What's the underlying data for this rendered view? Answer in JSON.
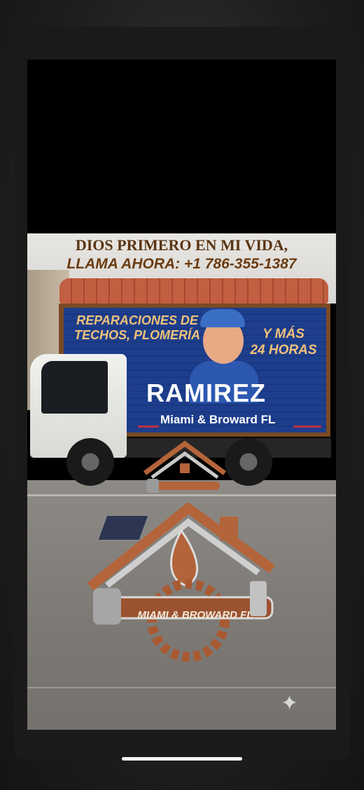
{
  "video": {
    "headline_line1": "DIOS PRIMERO EN MI VIDA,",
    "headline_line2": "LLAMA AHORA: +1 786-355-1387",
    "truck": {
      "left_text_line1": "REPARACIONES DE",
      "left_text_line2": "TECHOS, PLOMERÍA",
      "right_text_line1": "Y MÁS",
      "right_text_line2": "24 HORAS",
      "brand_name": "RAMIREZ",
      "brand_sub": "Miami & Broward FL"
    },
    "logo_text": "MIAMI & BROWARD FL",
    "sparkle_icon": "sparkle-icon"
  },
  "colors": {
    "headline": "#5a3512",
    "truck_blue": "#1d3e8c",
    "accent_copper": "#b4643a"
  }
}
